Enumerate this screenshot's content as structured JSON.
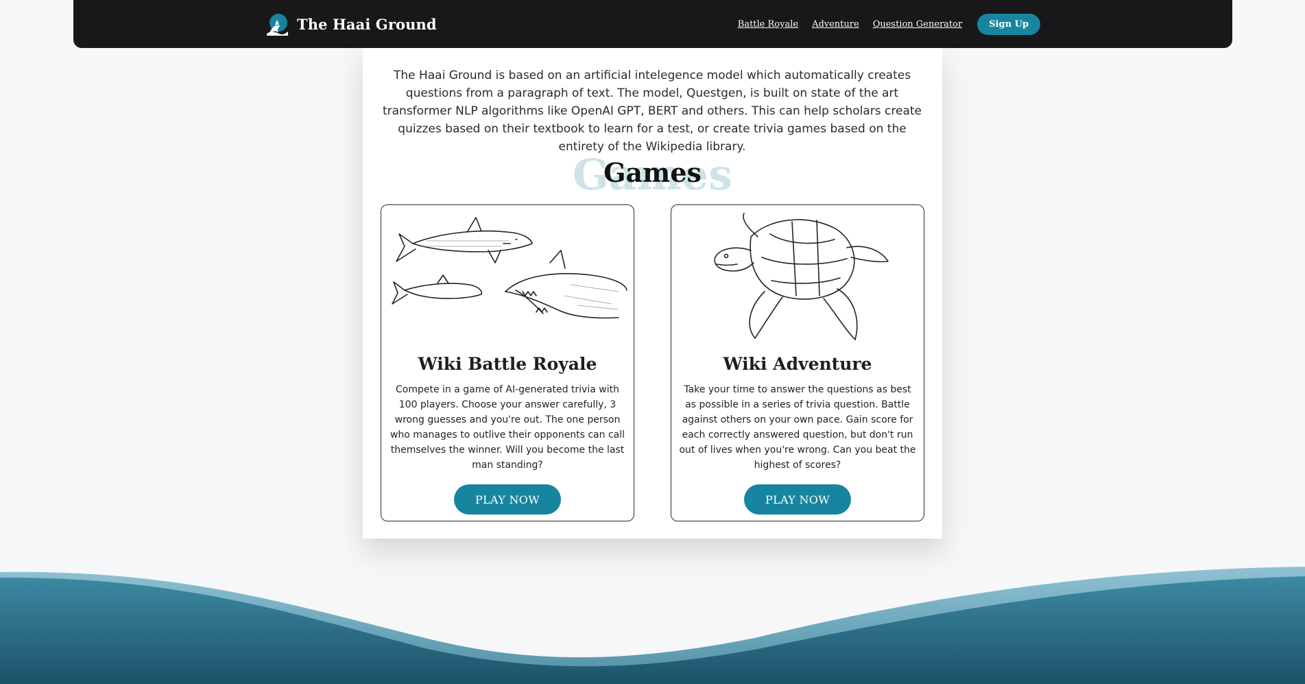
{
  "colors": {
    "accent": "#1785a0",
    "navbar": "#18181a",
    "page_bg": "#f6f7f9",
    "wave_light": "#7fb6c9",
    "wave_dark": "#1f5a70"
  },
  "navbar": {
    "logo_icon": "shark-wave-logo-icon",
    "brand": "The Haai Ground",
    "links": [
      "Battle Royale",
      "Adventure",
      "Question Generator"
    ],
    "signup": "Sign Up"
  },
  "intro": "The Haai Ground is based on an artificial intelegence model which automatically creates questions from a paragraph of text. The model, Questgen, is built on state of the art transformer NLP algorithms like OpenAI GPT, BERT and others. This can help scholars create quizzes based on their textbook to learn for a test, or create trivia games based on the entirety of the Wikipedia library.",
  "games": {
    "title": "Games",
    "title_shadow": "Games",
    "cards": [
      {
        "image_icon": "sharks-sketch-illustration",
        "title": "Wiki Battle Royale",
        "description": "Compete in a game of AI-generated trivia with 100 players. Choose your answer carefully, 3 wrong guesses and you're out. The one person who manages to outlive their opponents can call themselves the winner. Will you become the last man standing?",
        "button": "PLAY NOW"
      },
      {
        "image_icon": "sea-turtle-sketch-illustration",
        "title": "Wiki Adventure",
        "description": "Take your time to answer the questions as best as possible in a series of trivia question. Battle against others on your own pace. Gain score for each correctly answered question, but don't run out of lives when you're wrong. Can you beat the highest of scores?",
        "button": "PLAY NOW"
      }
    ]
  }
}
